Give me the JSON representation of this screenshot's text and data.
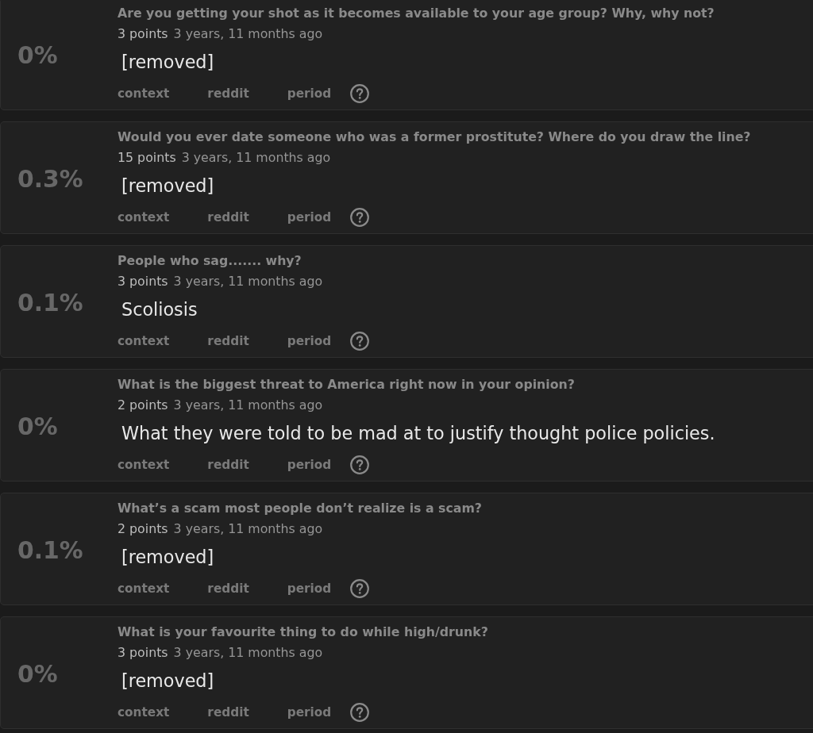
{
  "posts": [
    {
      "percent": "0%",
      "title": "Are you getting your shot as it becomes available to your age group? Why, why not?",
      "points": "3 points",
      "time": "3 years, 11 months ago",
      "body": "[removed]",
      "actions": [
        "context",
        "reddit",
        "period"
      ]
    },
    {
      "percent": "0.3%",
      "title": "Would you ever date someone who was a former prostitute? Where do you draw the line?",
      "points": "15 points",
      "time": "3 years, 11 months ago",
      "body": "[removed]",
      "actions": [
        "context",
        "reddit",
        "period"
      ]
    },
    {
      "percent": "0.1%",
      "title": "People who sag....... why?",
      "points": "3 points",
      "time": "3 years, 11 months ago",
      "body": "Scoliosis",
      "actions": [
        "context",
        "reddit",
        "period"
      ]
    },
    {
      "percent": "0%",
      "title": "What is the biggest threat to America right now in your opinion?",
      "points": "2 points",
      "time": "3 years, 11 months ago",
      "body": "What they were told to be mad at to justify thought police policies.",
      "actions": [
        "context",
        "reddit",
        "period"
      ]
    },
    {
      "percent": "0.1%",
      "title": "What’s a scam most people don’t realize is a scam?",
      "points": "2 points",
      "time": "3 years, 11 months ago",
      "body": "[removed]",
      "actions": [
        "context",
        "reddit",
        "period"
      ]
    },
    {
      "percent": "0%",
      "title": "What is your favourite thing to do while high/drunk?",
      "points": "3 points",
      "time": "3 years, 11 months ago",
      "body": "[removed]",
      "actions": [
        "context",
        "reddit",
        "period"
      ]
    }
  ]
}
